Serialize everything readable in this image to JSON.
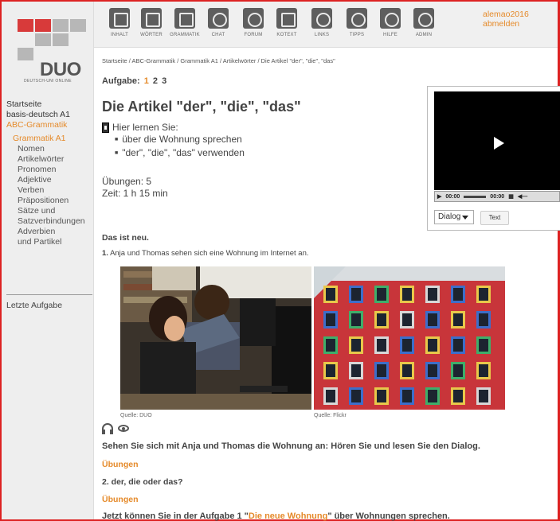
{
  "logo": {
    "word": "DUO",
    "sub": "DEUTSCH-UNI ONLINE"
  },
  "topbar": {
    "items": [
      {
        "label": "INHALT",
        "icon": "folder-icon"
      },
      {
        "label": "WÖRTER",
        "icon": "dictionary-icon"
      },
      {
        "label": "GRAMMATIK",
        "icon": "grammar-book-icon"
      },
      {
        "label": "CHAT",
        "icon": "chat-icon"
      },
      {
        "label": "FORUM",
        "icon": "forum-icon"
      },
      {
        "label": "KOTEXT",
        "icon": "kotext-icon"
      },
      {
        "label": "LINKS",
        "icon": "links-icon"
      },
      {
        "label": "TIPPS",
        "icon": "lightbulb-icon"
      },
      {
        "label": "HILFE",
        "icon": "help-icon"
      },
      {
        "label": "ADMIN",
        "icon": "admin-icon"
      }
    ]
  },
  "user": {
    "name": "alemao2016",
    "logout": "abmelden"
  },
  "sidebar": {
    "items": [
      {
        "label": "Startseite",
        "level": 0,
        "active": false
      },
      {
        "label": "basis-deutsch A1",
        "level": 0,
        "active": false
      },
      {
        "label": "ABC-Grammatik",
        "level": 0,
        "active": true
      },
      {
        "label": "Grammatik A1",
        "level": 1,
        "active": true
      },
      {
        "label": "Nomen",
        "level": 2,
        "active": false
      },
      {
        "label": "Artikelwörter",
        "level": 2,
        "active": true
      },
      {
        "label": "Pronomen",
        "level": 2,
        "active": false
      },
      {
        "label": "Adjektive",
        "level": 2,
        "active": false
      },
      {
        "label": "Verben",
        "level": 2,
        "active": false
      },
      {
        "label": "Präpositionen",
        "level": 2,
        "active": false
      },
      {
        "label": "Sätze und Satzverbindungen",
        "level": 2,
        "active": false
      },
      {
        "label": "Adverbien und Partikel",
        "level": 2,
        "active": false
      }
    ],
    "last_task": "Letzte Aufgabe"
  },
  "breadcrumb": "Startseite / ABC-Grammatik / Grammatik A1 / Artikelwörter / Die Artikel \"der\", \"die\", \"das\"",
  "aufgabe": {
    "label": "Aufgabe:",
    "pages": [
      "1",
      "2",
      "3"
    ],
    "current": "1"
  },
  "title": "Die Artikel \"der\", \"die\", \"das\"",
  "learn": {
    "heading": "Hier lernen Sie:",
    "points": [
      "über die Wohnung sprechen",
      "\"der\", \"die\", \"das\" verwenden"
    ]
  },
  "stats": {
    "uebungen": "Übungen: 5",
    "zeit": "Zeit: 1 h 15 min"
  },
  "video": {
    "time_current": "00:00",
    "time_total": "00:00",
    "select_value": "Dialog",
    "text_button": "Text"
  },
  "section": {
    "heading": "Das ist neu.",
    "line1_num": "1.",
    "line1": "Anja und Thomas sehen sich eine Wohnung im Internet an.",
    "src1": "Quelle: DUO",
    "src2": "Quelle: Flickr",
    "sehen": "Sehen Sie sich mit Anja und Thomas die Wohnung an: Hören Sie und lesen Sie den Dialog.",
    "ueb1": "Übungen",
    "q2": "2. der, die oder das?",
    "ueb2": "Übungen",
    "jetzt_pre": "Jetzt können Sie in der Aufgabe 1 \"",
    "jetzt_link": "Die neue Wohnung",
    "jetzt_post": "\" über Wohnungen sprechen."
  },
  "colors": {
    "accent": "#e58a2a",
    "frame": "#dd2222",
    "logo_red": "#d83a3a"
  }
}
